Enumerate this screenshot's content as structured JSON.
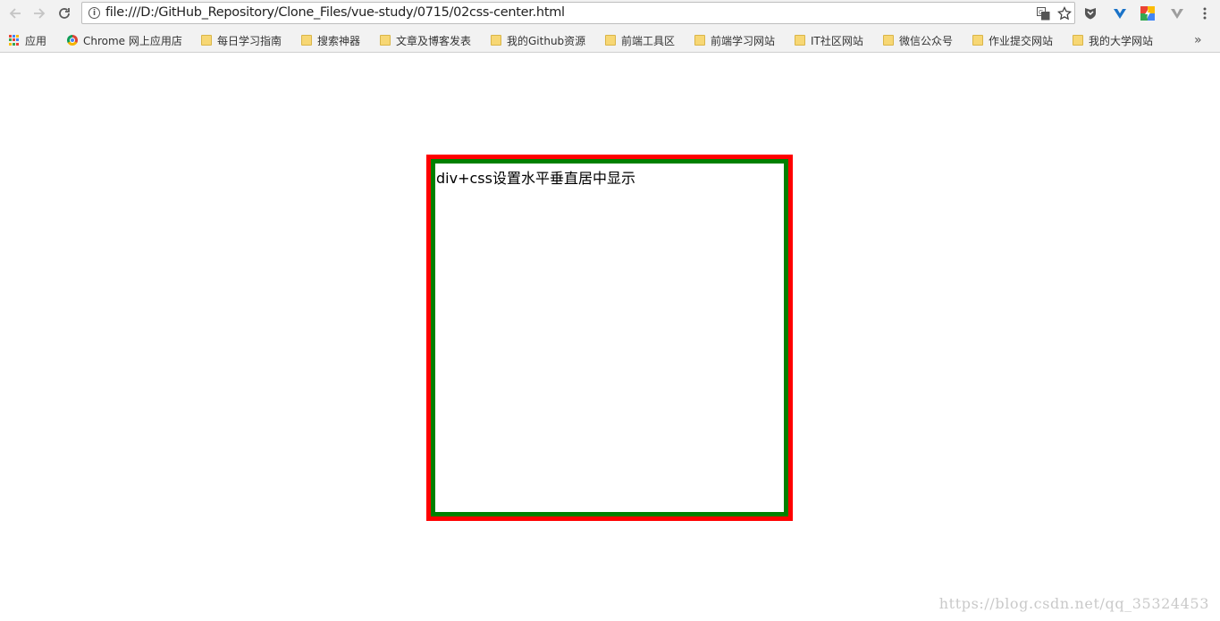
{
  "browser": {
    "url": "file:///D:/GitHub_Repository/Clone_Files/vue-study/0715/02css-center.html",
    "icons": {
      "back": "arrow-left-icon",
      "forward": "arrow-right-icon",
      "reload": "reload-icon",
      "info": "info-icon",
      "translate": "translate-icon",
      "star": "star-icon",
      "menu": "kebab-menu-icon"
    }
  },
  "bookmarks": {
    "items": [
      {
        "label": "应用",
        "icon": "apps-grid-icon"
      },
      {
        "label": "Chrome 网上应用店",
        "icon": "chrome-store-icon"
      },
      {
        "label": "每日学习指南",
        "icon": "folder-icon"
      },
      {
        "label": "搜索神器",
        "icon": "folder-icon"
      },
      {
        "label": "文章及博客发表",
        "icon": "folder-icon"
      },
      {
        "label": "我的Github资源",
        "icon": "folder-icon"
      },
      {
        "label": "前端工具区",
        "icon": "folder-icon"
      },
      {
        "label": "前端学习网站",
        "icon": "folder-icon"
      },
      {
        "label": "IT社区网站",
        "icon": "folder-icon"
      },
      {
        "label": "微信公众号",
        "icon": "folder-icon"
      },
      {
        "label": "作业提交网站",
        "icon": "folder-icon"
      },
      {
        "label": "我的大学网站",
        "icon": "folder-icon"
      }
    ],
    "overflow": "»"
  },
  "page": {
    "box_text": "div+css设置水平垂直居中显示",
    "outer_color": "#ff0000",
    "inner_color": "#008000"
  },
  "watermark": "https://blog.csdn.net/qq_35324453"
}
